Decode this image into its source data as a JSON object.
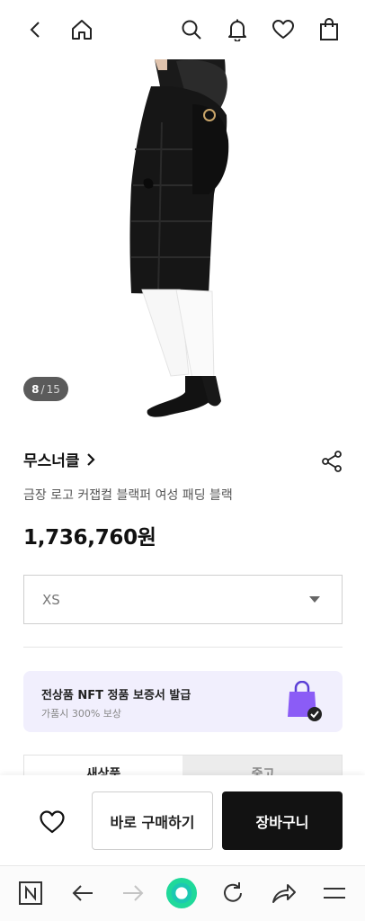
{
  "header": {
    "icons": [
      "back-icon",
      "home-icon",
      "search-icon",
      "bell-icon",
      "heart-icon",
      "bag-icon"
    ]
  },
  "gallery": {
    "current": "8",
    "separator": "/",
    "total": "15"
  },
  "product": {
    "brand": "무스너클",
    "title": "금장 로고 커잽컬 블랙퍼 여성 패딩 블랙",
    "price": "1,736,760원"
  },
  "option": {
    "selected": "XS"
  },
  "nft": {
    "title": "전상품 NFT 정품 보증서 발급",
    "subtitle": "가품시 300% 보상"
  },
  "tabs": [
    {
      "label": "새상품"
    },
    {
      "label": "중고"
    }
  ],
  "actions": {
    "buy_now": "바로 구매하기",
    "cart": "장바구니"
  },
  "browser": {
    "icons": [
      "naver-icon",
      "back-arrow-icon",
      "forward-arrow-icon",
      "green-dot-icon",
      "refresh-icon",
      "share-arrow-icon",
      "menu-icon"
    ]
  },
  "colors": {
    "accent": "#1fd99a",
    "nft_bg": "#f1effd",
    "bag_purple": "#8b5cf6",
    "cart_bg": "#121212"
  }
}
